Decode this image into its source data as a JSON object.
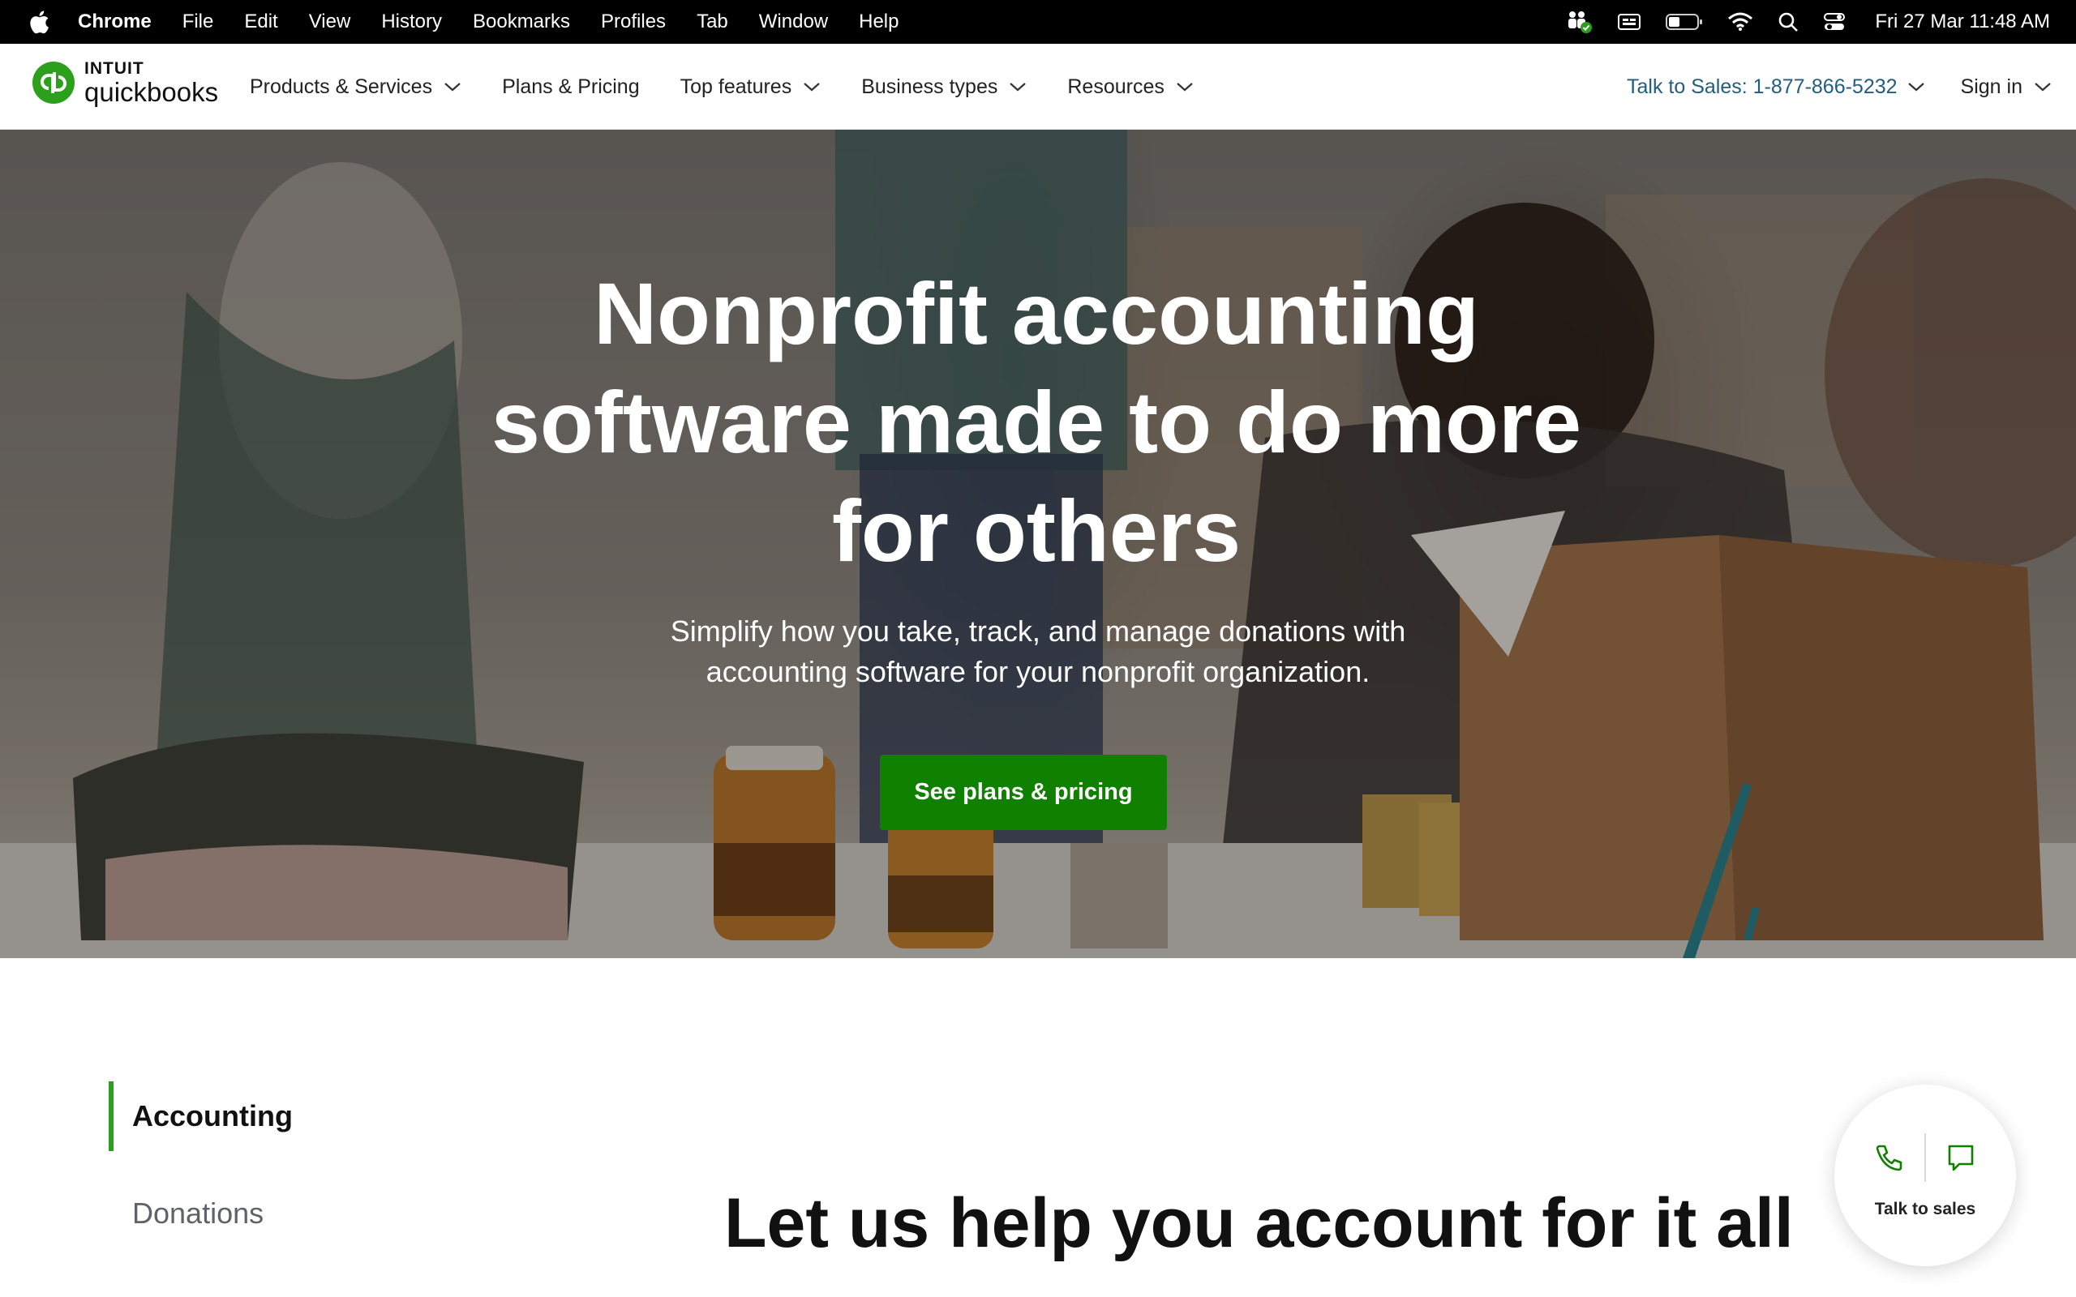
{
  "menubar": {
    "app": "Chrome",
    "items": [
      "File",
      "Edit",
      "View",
      "History",
      "Bookmarks",
      "Profiles",
      "Tab",
      "Window",
      "Help"
    ],
    "clock": "Fri 27 Mar  11:48 AM",
    "status_icons": [
      "family-sharing-icon",
      "display-icon",
      "battery-icon",
      "wifi-icon",
      "spotlight-search-icon",
      "control-center-icon"
    ]
  },
  "header": {
    "logo_top": "INTUIT",
    "logo_bottom": "quickbooks",
    "nav": [
      {
        "label": "Products & Services",
        "dropdown": true
      },
      {
        "label": "Plans & Pricing",
        "dropdown": false
      },
      {
        "label": "Top features",
        "dropdown": true
      },
      {
        "label": "Business types",
        "dropdown": true
      },
      {
        "label": "Resources",
        "dropdown": true
      }
    ],
    "sales": "Talk to Sales: 1-877-866-5232",
    "signin": "Sign in"
  },
  "hero": {
    "title_lines": [
      "Nonprofit accounting",
      "software made to do more",
      "for others"
    ],
    "subtitle_lines": [
      "Simplify how you take, track, and manage donations with",
      "accounting software for your nonprofit organization."
    ],
    "cta": "See plans & pricing"
  },
  "section": {
    "tabs": [
      "Accounting",
      "Donations"
    ],
    "active_tab": "Accounting",
    "heading": "Let us help you account for it all"
  },
  "widget": {
    "label": "Talk to sales"
  },
  "colors": {
    "brand_green": "#2ca01c",
    "cta_green": "#108000",
    "sales_link": "#215d80"
  }
}
